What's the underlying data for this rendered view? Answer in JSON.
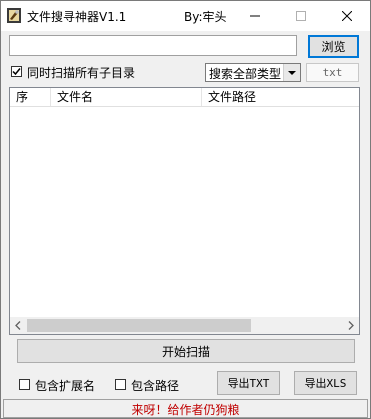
{
  "window": {
    "title": "文件搜寻神器V1.1",
    "author": "By:牢头"
  },
  "search": {
    "path_value": "",
    "browse_label": "浏览",
    "recursive_label": "同时扫描所有子目录",
    "recursive_checked": true,
    "type_selected": "搜索全部类型",
    "ext_value": "txt"
  },
  "table": {
    "columns": [
      "序",
      "文件名",
      "文件路径"
    ],
    "rows": []
  },
  "actions": {
    "start_label": "开始扫描",
    "include_ext_label": "包含扩展名",
    "include_ext_checked": false,
    "include_path_label": "包含路径",
    "include_path_checked": false,
    "export_txt_label": "导出TXT",
    "export_xls_label": "导出XLS"
  },
  "status": {
    "text": "来呀！给作者仍狗粮",
    "color": "#c00000"
  },
  "colors": {
    "focus_border": "#0078d7"
  },
  "icons": [
    "app-icon",
    "minimize-icon",
    "maximize-icon",
    "close-icon",
    "checkmark-icon",
    "chevron-down-icon",
    "scroll-left-icon",
    "scroll-right-icon"
  ]
}
